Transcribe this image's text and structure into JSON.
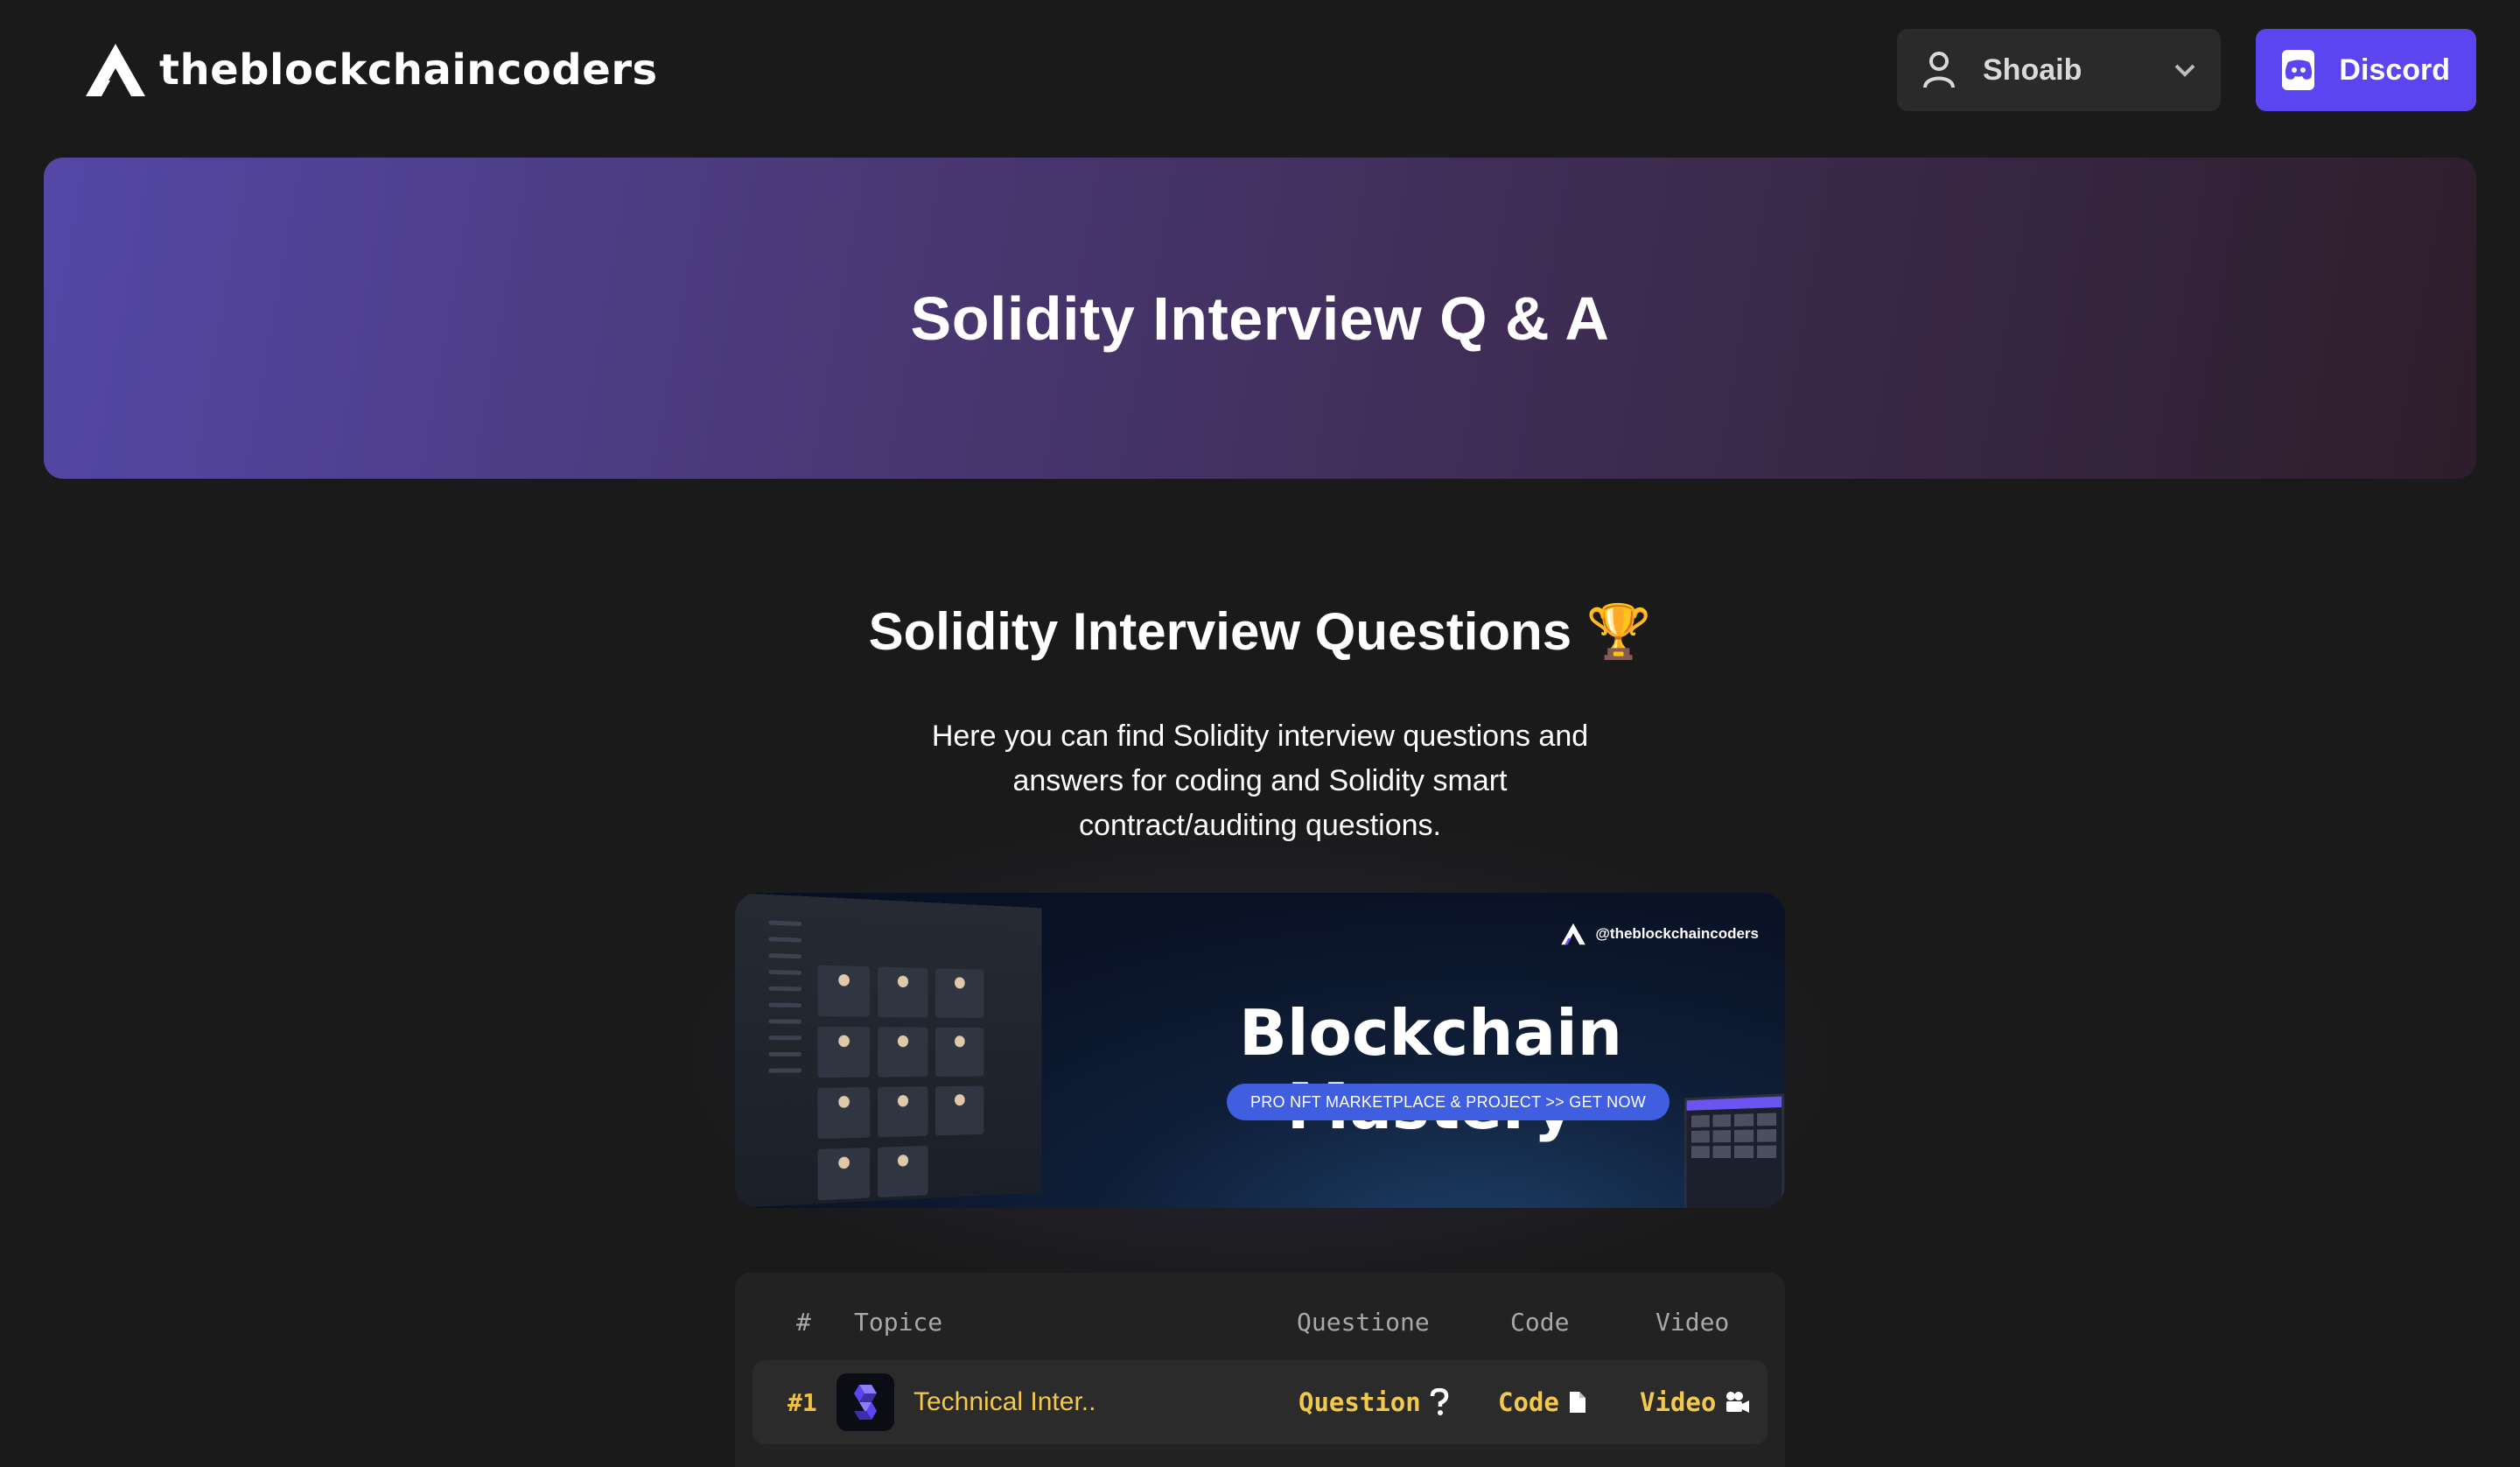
{
  "header": {
    "brand": "theblockchaincoders",
    "user": {
      "name": "Shoaib"
    },
    "discord_label": "Discord"
  },
  "hero": {
    "title": "Solidity Interview Q & A"
  },
  "section": {
    "title": "Solidity Interview Questions 🏆",
    "description": "Here you can find Solidity interview questions and answers for coding and Solidity smart contract/auditing questions."
  },
  "promo": {
    "handle": "@theblockchaincoders",
    "title": "Blockchain Mastery",
    "cta": "PRO NFT MARKETPLACE & PROJECT >> GET NOW"
  },
  "table": {
    "columns": [
      "#",
      "Topice",
      "Questione",
      "Code",
      "Video"
    ],
    "rows": [
      {
        "rank": "#1",
        "topic": "Technical Inter..",
        "question": "Question",
        "code": "Code",
        "video": "Video"
      }
    ]
  },
  "colors": {
    "background": "#1a1a1a",
    "accent": "#5b45f0",
    "link": "#f2c94c"
  }
}
